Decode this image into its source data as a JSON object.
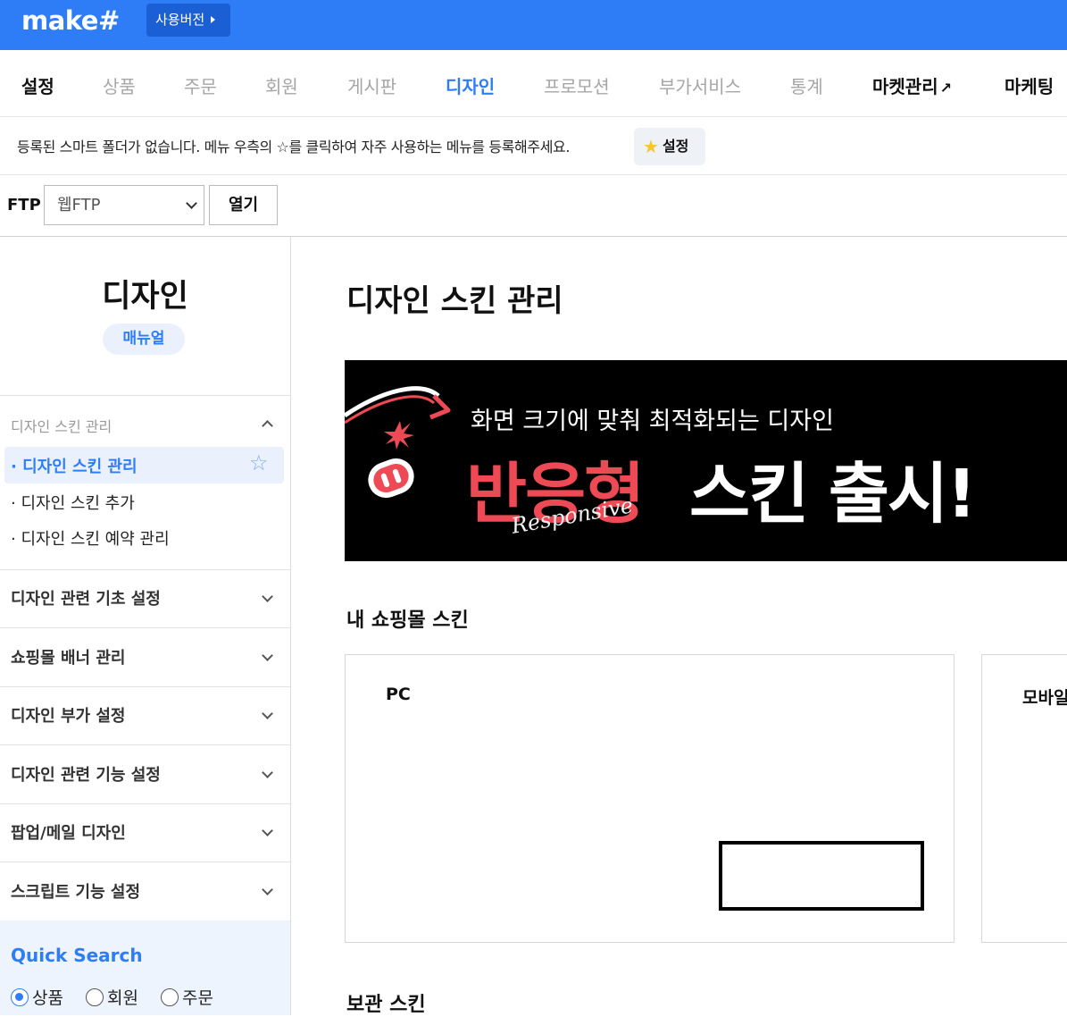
{
  "topbar": {
    "logo": "make#",
    "version_label": "사용버전"
  },
  "nav": {
    "items": [
      {
        "label": "설정"
      },
      {
        "label": "상품"
      },
      {
        "label": "주문"
      },
      {
        "label": "회원"
      },
      {
        "label": "게시판"
      },
      {
        "label": "디자인"
      },
      {
        "label": "프로모션"
      },
      {
        "label": "부가서비스"
      },
      {
        "label": "통계"
      },
      {
        "label": "마켓관리"
      },
      {
        "label": "마케팅"
      }
    ]
  },
  "smart_folder": {
    "message": "등록된 스마트 폴더가 없습니다. 메뉴 우측의 ☆를 클릭하여 자주 사용하는 메뉴를 등록해주세요.",
    "button_label": "설정"
  },
  "ftp": {
    "label": "FTP",
    "selected": "웹FTP",
    "open_label": "열기"
  },
  "sidebar": {
    "title": "디자인",
    "manual_label": "매뉴얼",
    "section_header": "디자인 스킨 관리",
    "sub_items": [
      {
        "label": "· 디자인 스킨 관리"
      },
      {
        "label": "· 디자인 스킨 추가"
      },
      {
        "label": "· 디자인 스킨 예약 관리"
      }
    ],
    "groups": [
      {
        "label": "디자인 관련 기초 설정"
      },
      {
        "label": "쇼핑몰 배너 관리"
      },
      {
        "label": "디자인 부가 설정"
      },
      {
        "label": "디자인 관련 기능 설정"
      },
      {
        "label": "팝업/메일 디자인"
      },
      {
        "label": "스크립트 기능 설정"
      }
    ],
    "quick_search": {
      "title": "Quick Search",
      "options": [
        "상품",
        "회원",
        "주문"
      ],
      "selected": "상품"
    }
  },
  "main": {
    "title": "디자인 스킨 관리",
    "banner": {
      "subtitle": "화면 크기에 맞춰 최적화되는 디자인",
      "headline_red": "반응형",
      "headline_white": "스킨 출시!",
      "script": "Responsive"
    },
    "my_skins_title": "내 쇼핑몰 스킨",
    "cards": [
      {
        "label": "PC"
      },
      {
        "label": "모바일"
      }
    ],
    "archive_title": "보관 스킨"
  }
}
